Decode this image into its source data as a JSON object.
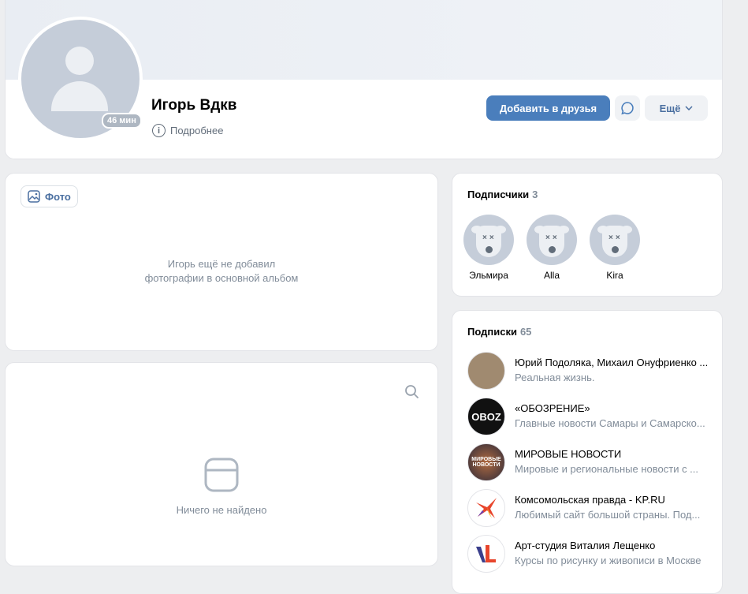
{
  "profile": {
    "name": "Игорь Вдкв",
    "online": "46 мин",
    "details": "Подробнее",
    "add_friend": "Добавить в друзья",
    "more": "Ещё"
  },
  "photos": {
    "button": "Фото",
    "empty_line1": "Игорь ещё не добавил",
    "empty_line2": "фотографии в основной альбом"
  },
  "wall": {
    "empty": "Ничего не найдено"
  },
  "followers": {
    "title": "Подписчики",
    "count": "3",
    "items": [
      {
        "name": "Эльмира"
      },
      {
        "name": "Alla"
      },
      {
        "name": "Kira"
      }
    ]
  },
  "subscriptions": {
    "title": "Подписки",
    "count": "65",
    "items": [
      {
        "name": "Юрий Подоляка, Михаил Онуфриенко ...",
        "desc": "Реальная жизнь.",
        "avatar_color": "#a08a70"
      },
      {
        "name": "«ОБОЗРЕНИЕ»",
        "desc": "Главные новости Самары и Самарско...",
        "avatar_color": "#111111",
        "avatar_text": "OBOZ"
      },
      {
        "name": "МИРОВЫЕ НОВОСТИ",
        "desc": "Мировые и региональные новости с ...",
        "avatar_color": "#5a3b35",
        "avatar_text": "МИРОВЫЕ НОВОСТИ"
      },
      {
        "name": "Комсомольская правда - KP.RU",
        "desc": "Любимый сайт большой страны. Под...",
        "avatar_color": "#ffffff"
      },
      {
        "name": "Арт-студия Виталия Лещенко",
        "desc": "Курсы по рисунку и живописи в Москве",
        "avatar_color": "#ffffff"
      }
    ]
  }
}
